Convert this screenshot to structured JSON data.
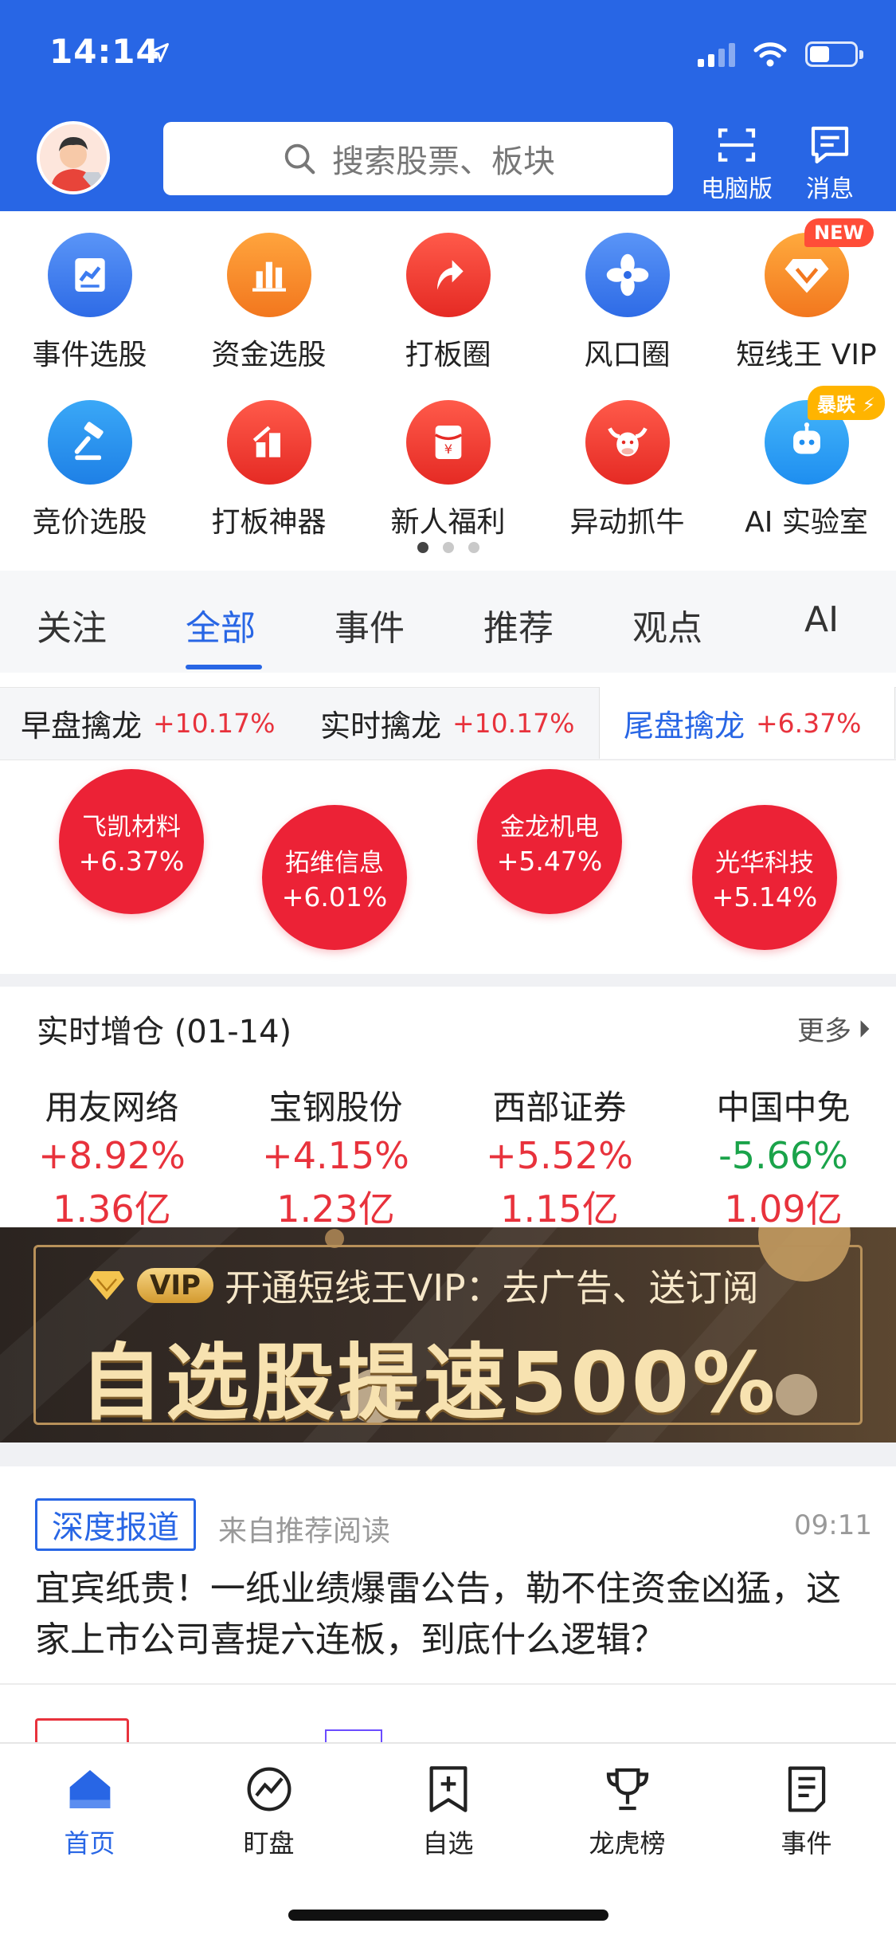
{
  "status": {
    "time": "14:14"
  },
  "header": {
    "search_placeholder": "搜索股票、板块",
    "desktop_label": "电脑版",
    "messages_label": "消息"
  },
  "grid": {
    "items": [
      {
        "label": "事件选股",
        "icon": "document-chart-icon",
        "color": "#3d7cf0"
      },
      {
        "label": "资金选股",
        "icon": "bar-chart-icon",
        "color": "#f28a1e"
      },
      {
        "label": "打板圈",
        "icon": "arrow-up-icon",
        "color": "#ea3a2f"
      },
      {
        "label": "风口圈",
        "icon": "fan-icon",
        "color": "#3d7cf0"
      },
      {
        "label": "短线王 VIP",
        "icon": "diamond-icon",
        "color": "#f29a1e",
        "badge": "NEW"
      },
      {
        "label": "竞价选股",
        "icon": "gavel-icon",
        "color": "#1e8ef0"
      },
      {
        "label": "打板神器",
        "icon": "rising-bars-icon",
        "color": "#ea3a2f"
      },
      {
        "label": "新人福利",
        "icon": "red-envelope-icon",
        "color": "#ea3a2f"
      },
      {
        "label": "异动抓牛",
        "icon": "bull-icon",
        "color": "#ea3a2f"
      },
      {
        "label": "AI 实验室",
        "icon": "robot-icon",
        "color": "#2aa3f3",
        "badge": "暴跌"
      }
    ]
  },
  "tabs": [
    "关注",
    "全部",
    "事件",
    "推荐",
    "观点",
    "AI"
  ],
  "subtabs": [
    {
      "name": "早盘擒龙",
      "pct": "+10.17%"
    },
    {
      "name": "实时擒龙",
      "pct": "+10.17%"
    },
    {
      "name": "尾盘擒龙",
      "pct": "+6.37%"
    }
  ],
  "bubbles": [
    {
      "name": "飞凯材料",
      "pct": "+6.37%"
    },
    {
      "name": "拓维信息",
      "pct": "+6.01%"
    },
    {
      "name": "金龙机电",
      "pct": "+5.47%"
    },
    {
      "name": "光华科技",
      "pct": "+5.14%"
    }
  ],
  "realtime": {
    "title": "实时增仓 (01-14)",
    "more": "更多",
    "stocks": [
      {
        "name": "用友网络",
        "change": "+8.92%",
        "amount": "1.36亿"
      },
      {
        "name": "宝钢股份",
        "change": "+4.15%",
        "amount": "1.23亿"
      },
      {
        "name": "西部证券",
        "change": "+5.52%",
        "amount": "1.15亿"
      },
      {
        "name": "中国中免",
        "change": "-5.66%",
        "amount": "1.09亿"
      }
    ]
  },
  "banner": {
    "vip": "VIP",
    "line1": "开通短线王VIP：去广告、送订阅",
    "line2": "自选股提速500%"
  },
  "news": {
    "tag": "深度报道",
    "source": "来自推荐阅读",
    "time": "09:11",
    "title": "宜宾纸贵！一纸业绩爆雷公告，勒不住资金凶猛，这家上市公司喜提六连板，到底什么逻辑？"
  },
  "bottom_nav": [
    "首页",
    "盯盘",
    "自选",
    "龙虎榜",
    "事件"
  ]
}
